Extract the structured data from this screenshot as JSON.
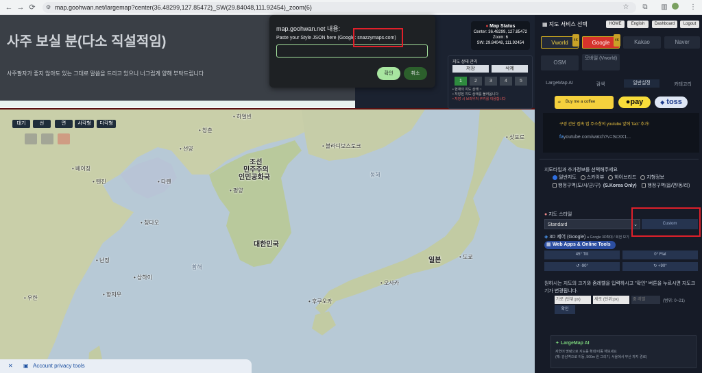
{
  "browser": {
    "url": "map.goohwan.net/largemap?center(36.48299,127.85472)_SW(29.84048,111.92454)_zoom(6)"
  },
  "banner": {
    "title": "사주 보실 분(다소 직설적임)",
    "subtitle": "사주팔자가 좋지 않아도 있는 그대로 말씀을 드리고 있으니 너그럽게 양해 부탁드립니다"
  },
  "dialog": {
    "title": "map.goohwan.net 내용:",
    "message": "Paste your Style JSON here (Google: snazzymaps.com)",
    "input_value": "",
    "ok_label": "확인",
    "cancel_label": "취소"
  },
  "map_status": {
    "title": "Map Status",
    "center": "Center: 36.48299, 127.85472",
    "zoom": "Zoom: 6",
    "sw": "SW: 29.84048, 111.92454"
  },
  "status_manager": {
    "title": "지도 상태 관리",
    "save_label": "저장",
    "delete_label": "삭제",
    "slots": [
      "1",
      "2",
      "3",
      "4",
      "5"
    ],
    "note1": "• 현재의 지도 상태 ~",
    "note2": "• 저장된 지도 상태를 불러옵니다",
    "note3": "• 저장 시 브라우저 쿠키를 이용합니다"
  },
  "map_tools": {
    "buttons": [
      "대기",
      "선",
      "면",
      "사각형",
      "다각형"
    ]
  },
  "map_labels": {
    "north_korea1": "조선",
    "north_korea2": "민주주의",
    "north_korea3": "인민공화국",
    "pyongyang": "평양",
    "south_korea": "대한민국",
    "japan": "일본",
    "beijing": "베이징",
    "tianjin": "톈진",
    "shenyang": "선양",
    "dalian": "다롄",
    "qingdao": "칭다오",
    "nanjing": "난징",
    "shanghai": "상하이",
    "hangzhou": "항저우",
    "wuhan": "우한",
    "osaka": "오사카",
    "tokyo": "도쿄",
    "fukuoka": "후쿠오카",
    "sapporo": "삿포로",
    "vladivostok": "블라디보스토크",
    "changchun": "창춘",
    "harbin": "하얼빈",
    "east_sea": "동해",
    "yellow_sea": "황해"
  },
  "panel": {
    "title": "지도 서비스 선택",
    "top_buttons": [
      "HOME",
      "English",
      "Dashboard",
      "Logout"
    ],
    "services_row1": [
      "Vworld",
      "Google",
      "Kakao",
      "Naver"
    ],
    "services_row2": [
      "OSM",
      "모바일 (Vworld)"
    ],
    "badge": "4K",
    "tabs": [
      "LargeMap AI",
      "검색",
      "일반설정",
      "카테고리"
    ],
    "coffee": "Buy me a coffee",
    "kpay": "pay",
    "toss": "toss",
    "ad_line": "구경 간단 접속 법  주소창의 youtube 앞에 'fact' 추가!",
    "ad_url": "youtube.com/watch?v=Sc3X1...",
    "extra_info_label": "지도타입과 추가정보를 선택해주세요",
    "radio_options": [
      "일반지도",
      "스카이뷰",
      "하이브리드",
      "지형정보"
    ],
    "check1": "행정구역(도/시/군/구)",
    "check1_bold": "(S.Korea Only)",
    "check2": "행정구역(읍/면/동/리)",
    "style_label": "지도 스타일",
    "style_select": "Standard",
    "custom_label": "Custom",
    "d3_label": "3D 제어 (Google)",
    "d3_note": "● Google 3D확대 / 회전 보기",
    "web_apps": "Web Apps & Online Tools",
    "tilt45": "45° Tilt",
    "flat": "0° Flat",
    "rot_left": "↺ -90°",
    "rot_right": "↻ +90°",
    "zoom_desc1": "원하시는 지도의 크기와 줌레벨을 입력하시고 \"확인\" 버튼을 누르시면 지도크",
    "zoom_desc2": "기가 변경됩니다.",
    "width_placeholder": "가로 (단위:px)",
    "height_placeholder": "세로 (단위:px)",
    "zoom_placeholder": "줌 레벨",
    "zoom_range": "(범위: 0~21)",
    "confirm": "확인",
    "ai_title": "LargeMap AI",
    "ai_line1": "자연어 명령으로 지도를 확대/이동 해보세요",
    "ai_line2": "(예: 강남역으로 이동, 500m 원 그리기, 서울에서 부산 까지 경로)"
  },
  "privacy": {
    "label": "Account privacy tools"
  }
}
